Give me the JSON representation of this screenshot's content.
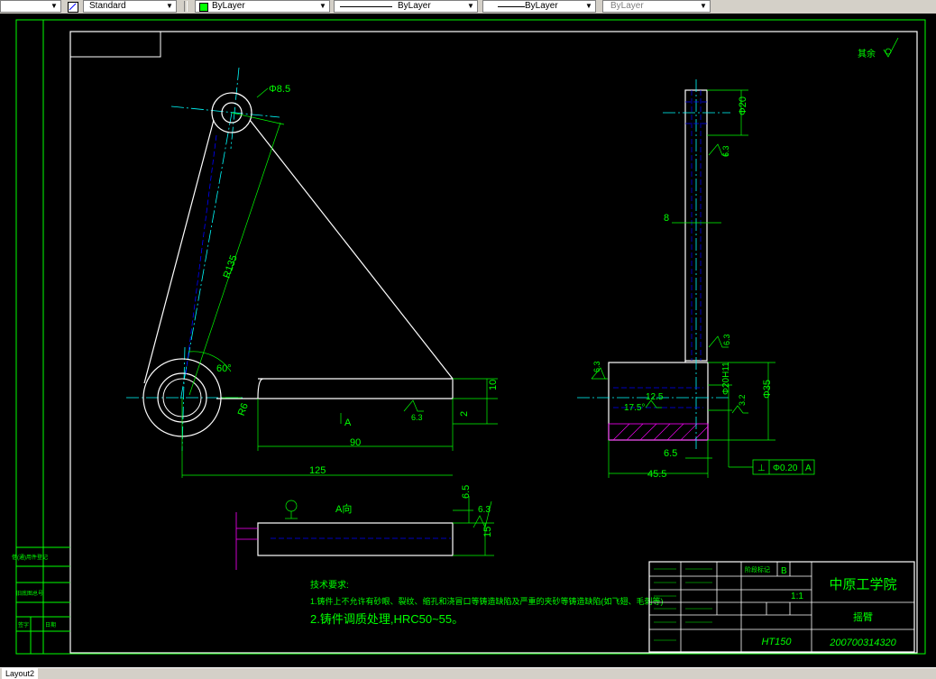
{
  "toolbar": {
    "text_style": "Standard",
    "layer": "ByLayer",
    "linetype": "ByLayer",
    "lineweight": "ByLayer",
    "plot_style": "ByLayer"
  },
  "colors": {
    "background": "#000000",
    "geometry": "#ffffff",
    "dimension": "#00ff00",
    "centerline": "#00ffff",
    "hidden": "#0000ff",
    "section": "#ff00ff"
  },
  "drawing": {
    "dims": {
      "phi_small": "Φ8.5",
      "r_big": "R135",
      "angle": "60°",
      "r_hole": "R6",
      "d90": "90",
      "d125": "125",
      "d10": "10",
      "d2": "2",
      "view_marker": "A",
      "rough_63": "6.3",
      "phi20": "Φ20",
      "d8": "8",
      "rough_63b": "6.3",
      "rough_63c": "6.3",
      "rough_63d": "6.3",
      "d125b": "12.5",
      "ang175": "17.5°",
      "phi20h11": "Φ20H11",
      "phi35": "Φ35",
      "rough_32": "3.2",
      "d65": "6.5",
      "d455": "45.5",
      "tol_perp": "⊥",
      "tol_value": "Φ0.20",
      "tol_datum": "A",
      "d65b": "6.5",
      "rough_63e": "6.3",
      "d15": "15",
      "view_a_label": "A向",
      "other_mark": "其余"
    },
    "notes": {
      "title": "技术要求:",
      "line1": "1.铸件上不允许有砂眼、裂纹、缩孔和浇冒口等铸造缺陷及严重的夹砂等铸造缺陷(如飞翅、毛刺等)",
      "line2": "2.铸件调质处理,HRC50~55。"
    },
    "title_block": {
      "school": "中原工学院",
      "part_name": "摇臂",
      "material": "HT150",
      "scale": "1:1",
      "drawing_no": "200700314320",
      "sheet_label": "阶段标记",
      "grade": "B"
    },
    "left_strip": {
      "a": "借(通)用件登记",
      "b": "旧底图总号",
      "c": "签字",
      "d": "日期"
    }
  },
  "status": {
    "layout_tab": "Layout2"
  }
}
